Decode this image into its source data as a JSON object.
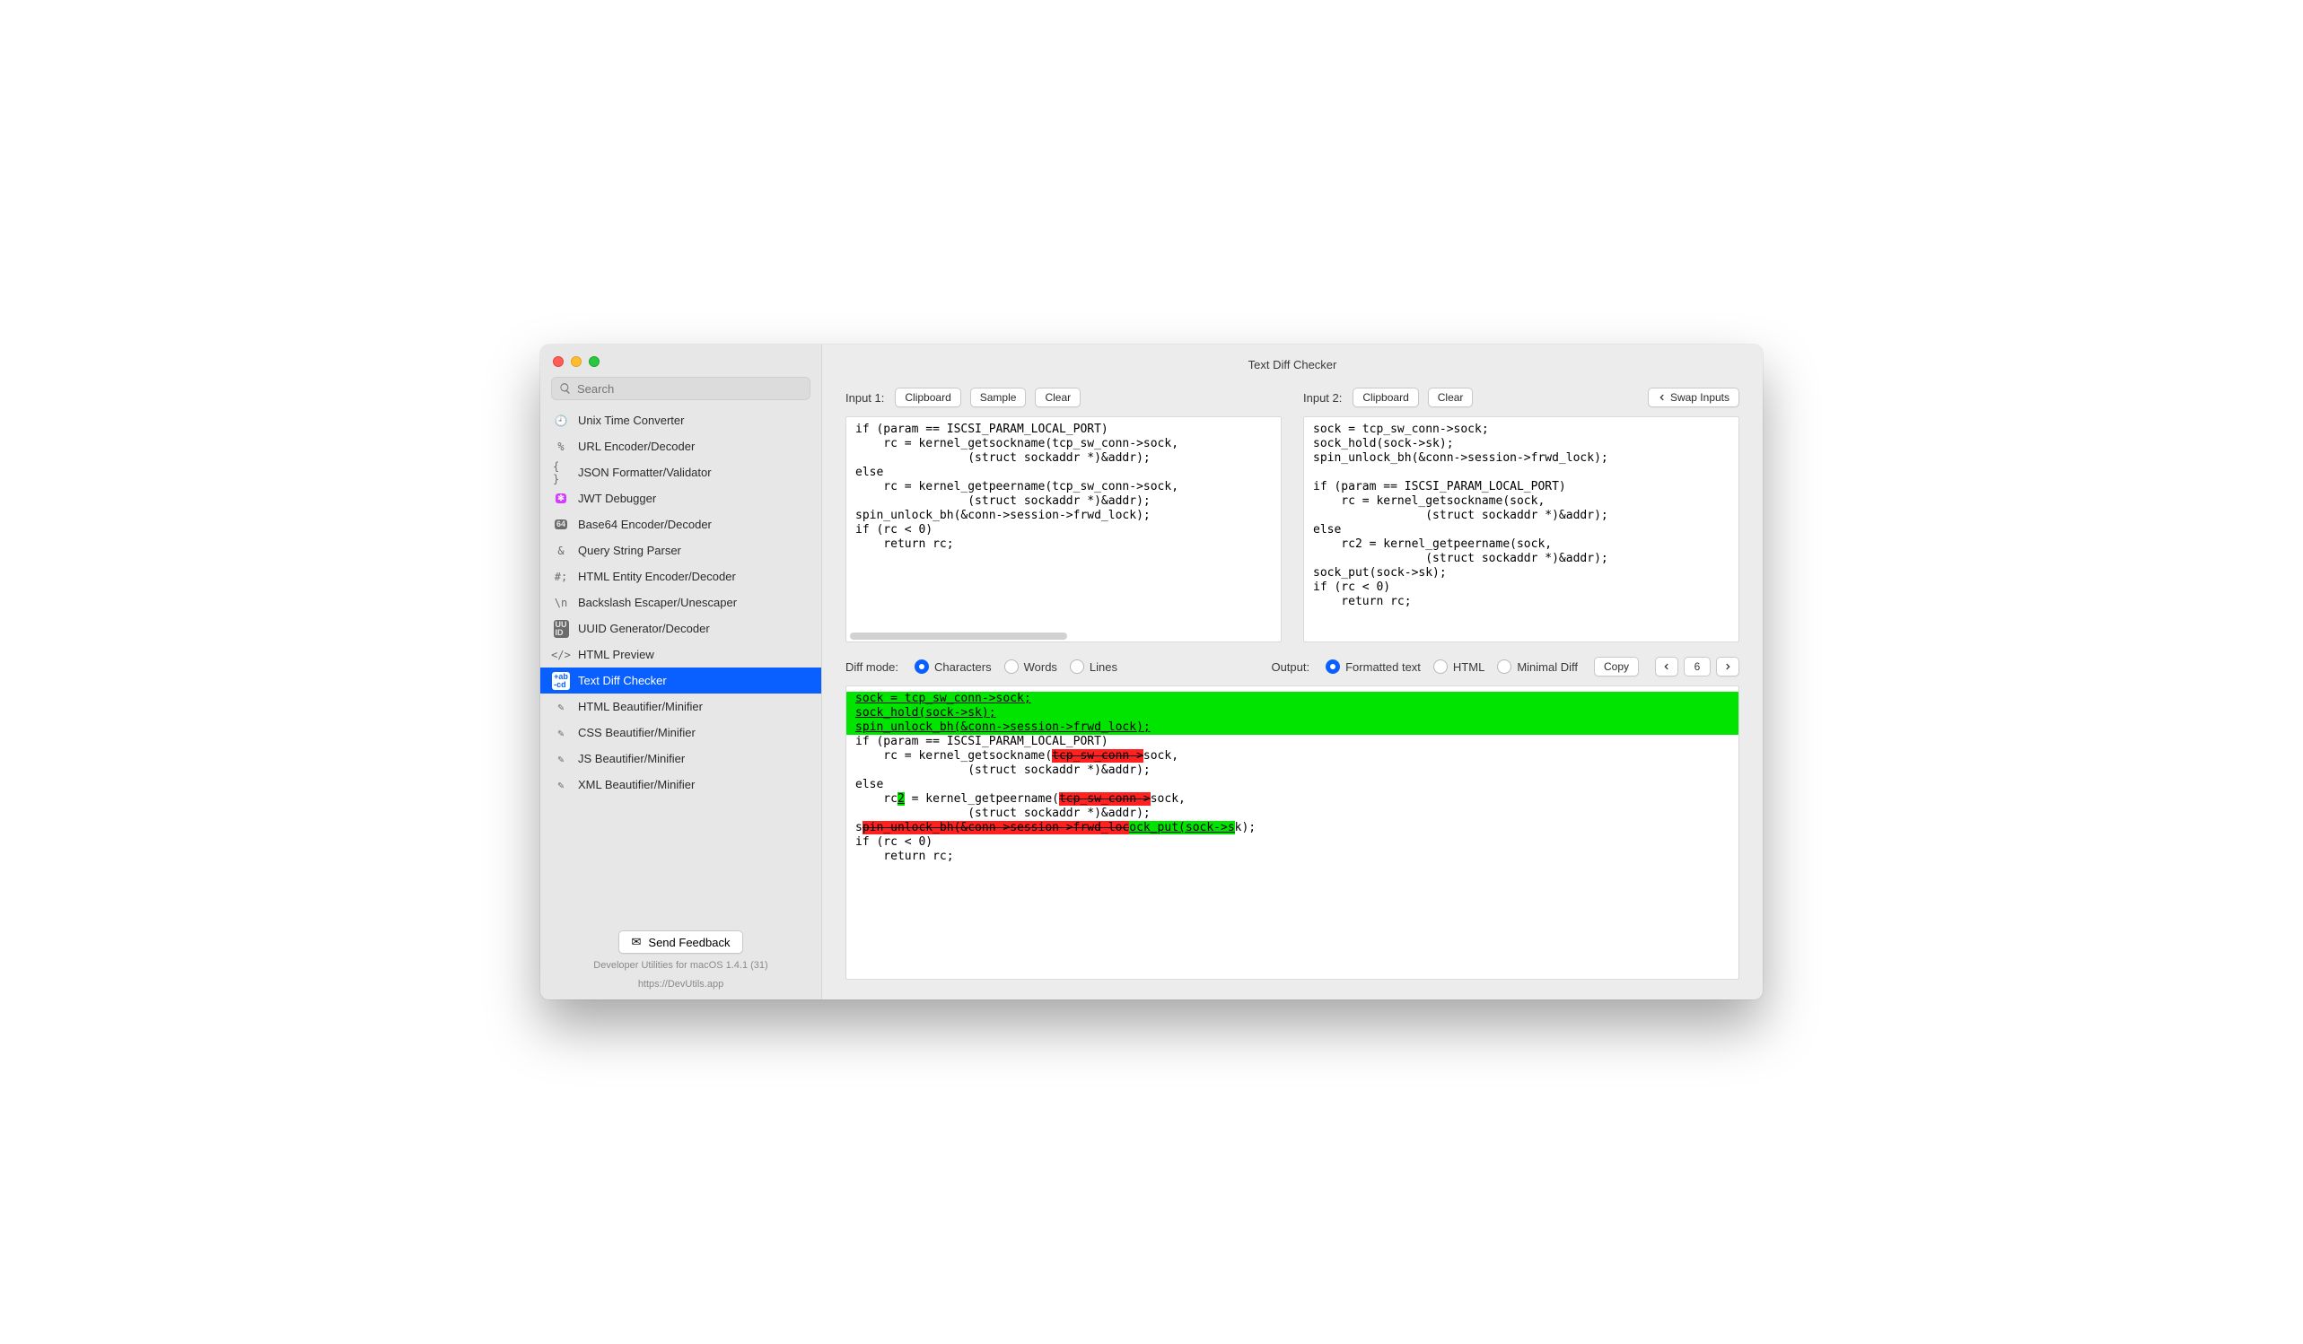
{
  "window": {
    "title": "Text Diff Checker"
  },
  "search": {
    "placeholder": "Search"
  },
  "sidebar": {
    "items": [
      {
        "label": "Unix Time Converter",
        "icon": "clock"
      },
      {
        "label": "URL Encoder/Decoder",
        "icon": "percent"
      },
      {
        "label": "JSON Formatter/Validator",
        "icon": "braces"
      },
      {
        "label": "JWT Debugger",
        "icon": "jwt"
      },
      {
        "label": "Base64 Encoder/Decoder",
        "icon": "b64"
      },
      {
        "label": "Query String Parser",
        "icon": "ampersand"
      },
      {
        "label": "HTML Entity Encoder/Decoder",
        "icon": "hashsemi"
      },
      {
        "label": "Backslash Escaper/Unescaper",
        "icon": "backslash-n"
      },
      {
        "label": "UUID Generator/Decoder",
        "icon": "uuid"
      },
      {
        "label": "HTML Preview",
        "icon": "angle-brackets"
      },
      {
        "label": "Text Diff Checker",
        "icon": "abcd",
        "active": true
      },
      {
        "label": "HTML Beautifier/Minifier",
        "icon": "wand"
      },
      {
        "label": "CSS Beautifier/Minifier",
        "icon": "wand"
      },
      {
        "label": "JS Beautifier/Minifier",
        "icon": "wand"
      },
      {
        "label": "XML Beautifier/Minifier",
        "icon": "wand"
      }
    ]
  },
  "footer": {
    "feedback": "Send Feedback",
    "meta1": "Developer Utilities for macOS 1.4.1 (31)",
    "meta2": "https://DevUtils.app"
  },
  "inputs": {
    "left": {
      "label": "Input 1:",
      "buttons": {
        "clipboard": "Clipboard",
        "sample": "Sample",
        "clear": "Clear"
      },
      "code": "if (param == ISCSI_PARAM_LOCAL_PORT)\n    rc = kernel_getsockname(tcp_sw_conn->sock,\n                (struct sockaddr *)&addr);\nelse\n    rc = kernel_getpeername(tcp_sw_conn->sock,\n                (struct sockaddr *)&addr);\nspin_unlock_bh(&conn->session->frwd_lock);\nif (rc < 0)\n    return rc;"
    },
    "right": {
      "label": "Input 2:",
      "buttons": {
        "clipboard": "Clipboard",
        "clear": "Clear",
        "swap": "Swap Inputs"
      },
      "code": "sock = tcp_sw_conn->sock;\nsock_hold(sock->sk);\nspin_unlock_bh(&conn->session->frwd_lock);\n\nif (param == ISCSI_PARAM_LOCAL_PORT)\n    rc = kernel_getsockname(sock,\n                (struct sockaddr *)&addr);\nelse\n    rc2 = kernel_getpeername(sock,\n                (struct sockaddr *)&addr);\nsock_put(sock->sk);\nif (rc < 0)\n    return rc;"
    }
  },
  "controls": {
    "diff_mode_label": "Diff mode:",
    "diff_modes": {
      "characters": "Characters",
      "words": "Words",
      "lines": "Lines",
      "selected": "characters"
    },
    "output_label": "Output:",
    "outputs": {
      "formatted": "Formatted text",
      "html": "HTML",
      "minimal": "Minimal Diff",
      "selected": "formatted"
    },
    "copy": "Copy",
    "nav_count": "6"
  },
  "diff": {
    "added_block": [
      "sock = tcp_sw_conn->sock;",
      "sock_hold(sock->sk);",
      "spin_unlock_bh(&conn->session->frwd_lock);",
      ""
    ],
    "l_if": "if (param == ISCSI_PARAM_LOCAL_PORT)",
    "l_rc1a": "    rc = kernel_getsockname(",
    "l_rc1_del": "tcp_sw_conn->",
    "l_rc1b": "sock,",
    "l_addr1": "                (struct sockaddr *)&addr);",
    "l_else": "else",
    "l_rc2a": "    rc",
    "l_rc2_ins": "2",
    "l_rc2b": " = kernel_getpeername(",
    "l_rc2_del": "tcp_sw_conn->",
    "l_rc2c": "sock,",
    "l_addr2": "                (struct sockaddr *)&addr);",
    "l_s": "s",
    "l_spin_del": "pin_unlock_bh(&conn->session->frwd_loc",
    "l_sock_ins": "ock_put(sock->s",
    "l_k_tail": "k);",
    "l_ifrc": "if (rc < 0)",
    "l_ret": "    return rc;"
  }
}
